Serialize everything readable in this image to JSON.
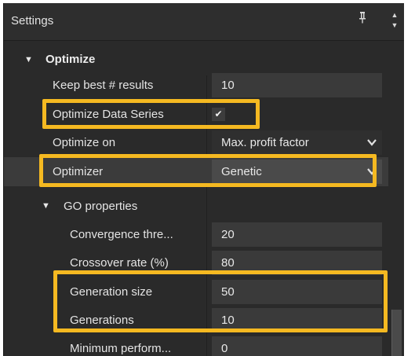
{
  "panel": {
    "title": "Settings",
    "pin_icon": "pin-icon",
    "scroll_icon": "scroll-up-down-icon"
  },
  "section": {
    "label": "Optimize",
    "expanded": true
  },
  "rows": {
    "keep_best": {
      "label": "Keep best # results",
      "value": "10"
    },
    "optimize_data_series": {
      "label": "Optimize Data Series",
      "checked": true,
      "check_glyph": "✔"
    },
    "optimize_on": {
      "label": "Optimize on",
      "value": "Max. profit factor"
    },
    "optimizer": {
      "label": "Optimizer",
      "value": "Genetic"
    }
  },
  "go_properties": {
    "label": "GO properties",
    "expanded": true,
    "rows": {
      "convergence": {
        "label": "Convergence thre...",
        "value": "20"
      },
      "crossover": {
        "label": "Crossover rate (%)",
        "value": "80"
      },
      "generation_size": {
        "label": "Generation size",
        "value": "50"
      },
      "generations": {
        "label": "Generations",
        "value": "10"
      },
      "min_perf": {
        "label": "Minimum perform...",
        "value": "0"
      }
    }
  },
  "colors": {
    "panel_bg": "#2a2a2a",
    "field_bg": "#3a3a3a",
    "highlight": "#f5b921",
    "text": "#e4e4e4"
  }
}
